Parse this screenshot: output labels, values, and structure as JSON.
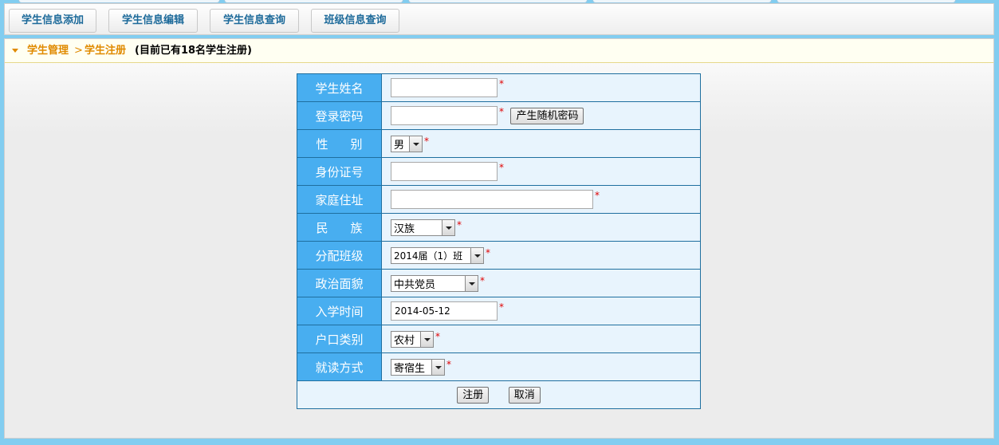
{
  "toolbar": {
    "buttons": [
      "学生信息添加",
      "学生信息编辑",
      "学生信息查询",
      "班级信息查询"
    ]
  },
  "breadcrumb": {
    "items": [
      "学生管理",
      "学生注册"
    ],
    "separator": ">",
    "note": "(目前已有18名学生注册)"
  },
  "form": {
    "name_label": "学生姓名",
    "name_value": "",
    "password_label": "登录密码",
    "password_value": "",
    "generate_password_button": "产生随机密码",
    "gender_label_chars": [
      "性",
      "别"
    ],
    "gender_value": "男",
    "id_label": "身份证号",
    "id_value": "",
    "address_label": "家庭住址",
    "address_value": "",
    "ethnicity_label_chars": [
      "民",
      "族"
    ],
    "ethnicity_value": "汉族",
    "class_label": "分配班级",
    "class_value": "2014届（1）班",
    "political_label": "政治面貌",
    "political_value": "中共党员",
    "enroll_date_label": "入学时间",
    "enroll_date_value": "2014-05-12",
    "hukou_label": "户口类别",
    "hukou_value": "农村",
    "study_mode_label": "就读方式",
    "study_mode_value": "寄宿生",
    "required_mark": "*",
    "submit_button": "注册",
    "cancel_button": "取消"
  },
  "colors": {
    "background": "#82cdf0",
    "label_cell": "#48aef0",
    "field_cell": "#e8f4fd",
    "accent_orange": "#e08a00",
    "toolbar_text": "#1d6a9a",
    "required": "#e00000"
  }
}
